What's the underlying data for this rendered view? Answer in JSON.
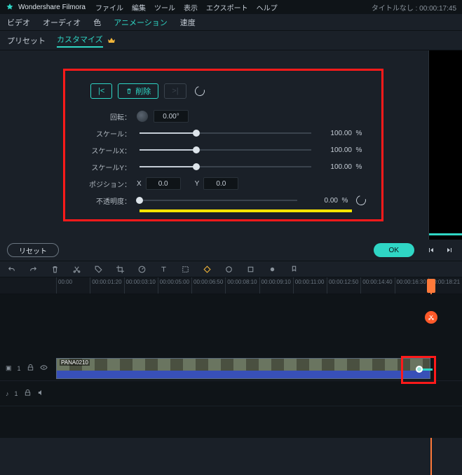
{
  "app": {
    "name": "Wondershare Filmora",
    "projectLabel": "タイトルなし :",
    "timecode": "00:00:17:45"
  },
  "menu": {
    "file": "ファイル",
    "edit": "編集",
    "tool": "ツール",
    "view": "表示",
    "export": "エクスポート",
    "help": "ヘルプ"
  },
  "tabs": {
    "video": "ビデオ",
    "audio": "オーディオ",
    "color": "色",
    "animation": "アニメーション",
    "speed": "速度"
  },
  "preset": {
    "preset": "プリセット",
    "customize": "カスタマイズ"
  },
  "keyframe": {
    "prev": "|<",
    "delete": "削除",
    "next": ">|"
  },
  "props": {
    "rotation": {
      "label": "回転：",
      "value": "0.00°"
    },
    "scale": {
      "label": "スケール：",
      "value": "100.00",
      "unit": "%",
      "pos": 33
    },
    "scaleX": {
      "label": "スケールX：",
      "value": "100.00",
      "unit": "%",
      "pos": 33
    },
    "scaleY": {
      "label": "スケールY：",
      "value": "100.00",
      "unit": "%",
      "pos": 33
    },
    "position": {
      "label": "ポジション：",
      "xLabel": "X",
      "x": "0.0",
      "yLabel": "Y",
      "y": "0.0"
    },
    "opacity": {
      "label": "不透明度：",
      "value": "0.00",
      "unit": "%",
      "pos": 0
    }
  },
  "buttons": {
    "reset": "リセット",
    "ok": "OK"
  },
  "ruler": [
    "00:00",
    "00:00:01:20",
    "00:00:03:10",
    "00:00:05:00",
    "00:00:06:50",
    "00:00:08:10",
    "00:00:09:10",
    "00:00:11:00",
    "00:00:12:50",
    "00:00:14:40",
    "00:00:16:30",
    "00:00:18:21"
  ],
  "tracks": {
    "video": "1",
    "audio": "1"
  },
  "clip": {
    "name": "PANA0210"
  }
}
